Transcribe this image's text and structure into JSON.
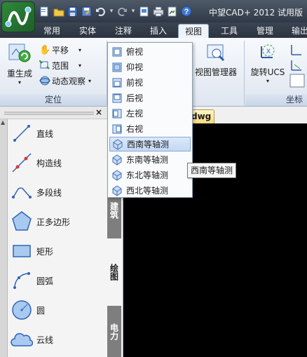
{
  "app": {
    "title": "中望CAD+ 2012 试用版"
  },
  "tabs": [
    {
      "label": "常用"
    },
    {
      "label": "实体"
    },
    {
      "label": "注释"
    },
    {
      "label": "插入"
    },
    {
      "label": "视图"
    },
    {
      "label": "工具"
    },
    {
      "label": "管理"
    },
    {
      "label": "输出"
    }
  ],
  "active_tab": "视图",
  "ribbon": {
    "regen_label": "重生成",
    "pan_label": "平移",
    "extents_label": "范围",
    "orbit_label": "动态观察",
    "group_locate": "定位",
    "view_manager_label": "视图管理器",
    "rotate_ucs_label": "旋转UCS",
    "group_coord": "坐标"
  },
  "view_menu": {
    "items": [
      {
        "label": "俯视"
      },
      {
        "label": "仰视"
      },
      {
        "label": "前视"
      },
      {
        "label": "后视"
      },
      {
        "label": "左视"
      },
      {
        "label": "右视"
      },
      {
        "label": "西南等轴测"
      },
      {
        "label": "东南等轴测"
      },
      {
        "label": "东北等轴测"
      },
      {
        "label": "西北等轴测"
      }
    ],
    "highlighted": "西南等轴测"
  },
  "tooltip": "西南等轴测",
  "document_tab": "dwg",
  "palette": {
    "close_glyph": "×",
    "tools": [
      {
        "label": "直线",
        "icon": "line-icon"
      },
      {
        "label": "构造线",
        "icon": "construction-line-icon"
      },
      {
        "label": "多段线",
        "icon": "polyline-icon"
      },
      {
        "label": "正多边形",
        "icon": "polygon-icon"
      },
      {
        "label": "矩形",
        "icon": "rectangle-icon"
      },
      {
        "label": "圆弧",
        "icon": "arc-icon"
      },
      {
        "label": "圆",
        "icon": "circle-icon"
      },
      {
        "label": "云线",
        "icon": "revision-cloud-icon"
      }
    ],
    "side_tabs": [
      {
        "label": "建筑"
      },
      {
        "label": "绘图"
      },
      {
        "label": "电力"
      }
    ],
    "active_side_tab": "绘图"
  }
}
